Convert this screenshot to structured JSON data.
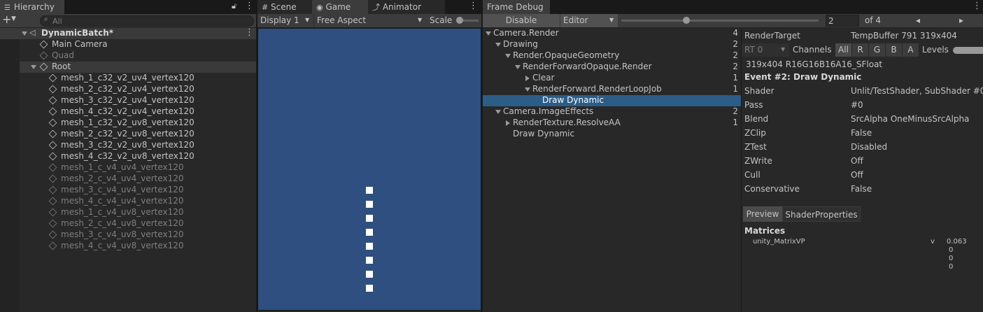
{
  "hierarchy": {
    "tab_label": "Hierarchy",
    "search_placeholder": "All",
    "scene_name": "DynamicBatch*",
    "items": [
      {
        "label": "Main Camera",
        "dim": false,
        "level": 1
      },
      {
        "label": "Quad",
        "dim": true,
        "level": 1
      },
      {
        "label": "Root",
        "dim": false,
        "level": 1
      },
      {
        "label": "mesh_1_c32_v2_uv4_vertex120",
        "dim": false,
        "level": 2
      },
      {
        "label": "mesh_2_c32_v2_uv4_vertex120",
        "dim": false,
        "level": 2
      },
      {
        "label": "mesh_3_c32_v2_uv4_vertex120",
        "dim": false,
        "level": 2
      },
      {
        "label": "mesh_4_c32_v2_uv4_vertex120",
        "dim": false,
        "level": 2
      },
      {
        "label": "mesh_1_c32_v2_uv8_vertex120",
        "dim": false,
        "level": 2
      },
      {
        "label": "mesh_2_c32_v2_uv8_vertex120",
        "dim": false,
        "level": 2
      },
      {
        "label": "mesh_3_c32_v2_uv8_vertex120",
        "dim": false,
        "level": 2
      },
      {
        "label": "mesh_4_c32_v2_uv8_vertex120",
        "dim": false,
        "level": 2
      },
      {
        "label": "mesh_1_c_v4_uv4_vertex120",
        "dim": true,
        "level": 2
      },
      {
        "label": "mesh_2_c_v4_uv4_vertex120",
        "dim": true,
        "level": 2
      },
      {
        "label": "mesh_3_c_v4_uv4_vertex120",
        "dim": true,
        "level": 2
      },
      {
        "label": "mesh_4_c_v4_uv4_vertex120",
        "dim": true,
        "level": 2
      },
      {
        "label": "mesh_1_c_v4_uv8_vertex120",
        "dim": true,
        "level": 2
      },
      {
        "label": "mesh_2_c_v4_uv8_vertex120",
        "dim": true,
        "level": 2
      },
      {
        "label": "mesh_3_c_v4_uv8_vertex120",
        "dim": true,
        "level": 2
      },
      {
        "label": "mesh_4_c_v4_uv8_vertex120",
        "dim": true,
        "level": 2
      }
    ]
  },
  "game": {
    "tabs": [
      "Scene",
      "Game",
      "Animator"
    ],
    "display": "Display 1",
    "aspect": "Free Aspect",
    "scale_label": "Scale",
    "square_count": 8,
    "viewport_color": "#2e4f7f"
  },
  "frame_debug": {
    "tab_label": "Frame Debug",
    "disable_label": "Disable",
    "editor_label": "Editor",
    "event_index": "2",
    "event_total": "of 4",
    "slider_fraction": 0.33,
    "tree": [
      {
        "label": "Camera.Render",
        "count": "4",
        "indent": 0,
        "arrow": "down"
      },
      {
        "label": "Drawing",
        "count": "2",
        "indent": 1,
        "arrow": "down"
      },
      {
        "label": "Render.OpaqueGeometry",
        "count": "2",
        "indent": 2,
        "arrow": "down"
      },
      {
        "label": "RenderForwardOpaque.Render",
        "count": "2",
        "indent": 3,
        "arrow": "down"
      },
      {
        "label": "Clear",
        "count": "1",
        "indent": 4,
        "arrow": "right"
      },
      {
        "label": "RenderForward.RenderLoopJob",
        "count": "1",
        "indent": 4,
        "arrow": "down"
      },
      {
        "label": "Draw Dynamic",
        "count": "",
        "indent": 5,
        "arrow": "none",
        "selected": true
      },
      {
        "label": "Camera.ImageEffects",
        "count": "2",
        "indent": 1,
        "arrow": "down"
      },
      {
        "label": "RenderTexture.ResolveAA",
        "count": "1",
        "indent": 2,
        "arrow": "right"
      },
      {
        "label": "Draw Dynamic",
        "count": "",
        "indent": 2,
        "arrow": "none"
      }
    ],
    "details": {
      "render_target_label": "RenderTarget",
      "render_target_value": "TempBuffer 791 319x404",
      "rt_label": "RT 0",
      "channels_label": "Channels",
      "channels": [
        "All",
        "R",
        "G",
        "B",
        "A"
      ],
      "levels_label": "Levels",
      "format": "319x404 R16G16B16A16_SFloat",
      "event_title": "Event #2: Draw Dynamic",
      "props": [
        {
          "k": "Shader",
          "v": "Unlit/TestShader, SubShader #0"
        },
        {
          "k": "Pass",
          "v": "#0"
        },
        {
          "k": "Blend",
          "v": "SrcAlpha OneMinusSrcAlpha"
        },
        {
          "k": "ZClip",
          "v": "False"
        },
        {
          "k": "ZTest",
          "v": "Disabled"
        },
        {
          "k": "ZWrite",
          "v": "Off"
        },
        {
          "k": "Cull",
          "v": "Off"
        },
        {
          "k": "Conservative",
          "v": "False"
        }
      ],
      "sub_tabs": [
        "Preview",
        "ShaderProperties"
      ],
      "matrices_label": "Matrices",
      "matrix_name": "unity_MatrixVP",
      "matrix_v": "v",
      "matrix_col": [
        "0.063",
        "0",
        "0",
        "0"
      ]
    }
  }
}
